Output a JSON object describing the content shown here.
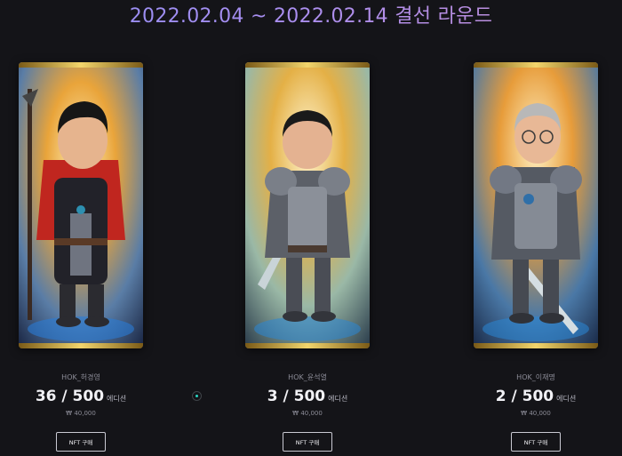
{
  "round": {
    "title": "2022.02.04 ~ 2022.02.14 결선 라운드"
  },
  "cards": [
    {
      "nickname": "HOK_허경영",
      "count": "36 / 500",
      "edition": "에디션",
      "price": "₩ 40,000",
      "button": "NFT 구매"
    },
    {
      "nickname": "HOK_윤석열",
      "count": "3 / 500",
      "edition": "에디션",
      "price": "₩ 40,000",
      "button": "NFT 구매"
    },
    {
      "nickname": "HOK_이재명",
      "count": "2 / 500",
      "edition": "에디션",
      "price": "₩ 40,000",
      "button": "NFT 구매"
    }
  ],
  "colors": {
    "background": "#141418",
    "frame_gold": "#c9a13a",
    "title_gradient_start": "#8f8ef5",
    "title_gradient_end": "#c58fd6",
    "dot_accent": "#2bd6c4"
  }
}
